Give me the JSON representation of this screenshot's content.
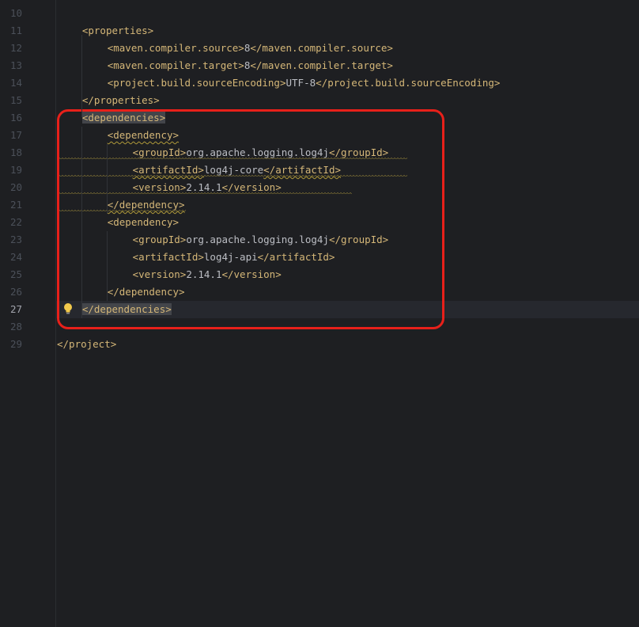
{
  "editor": {
    "current_line": "27",
    "lines": [
      {
        "num": "10",
        "parts": []
      },
      {
        "num": "11",
        "parts": [
          {
            "t": "tag",
            "v": "<properties>"
          }
        ]
      },
      {
        "num": "12",
        "parts": [
          {
            "t": "tag",
            "v": "<maven.compiler.source>"
          },
          {
            "t": "txt",
            "v": "8"
          },
          {
            "t": "tag",
            "v": "</maven.compiler.source>"
          }
        ]
      },
      {
        "num": "13",
        "parts": [
          {
            "t": "tag",
            "v": "<maven.compiler.target>"
          },
          {
            "t": "txt",
            "v": "8"
          },
          {
            "t": "tag",
            "v": "</maven.compiler.target>"
          }
        ]
      },
      {
        "num": "14",
        "parts": [
          {
            "t": "tag",
            "v": "<project.build.sourceEncoding>"
          },
          {
            "t": "txt",
            "v": "UTF-8"
          },
          {
            "t": "tag",
            "v": "</project.build.sourceEncoding>"
          }
        ]
      },
      {
        "num": "15",
        "parts": [
          {
            "t": "tag",
            "v": "</properties>"
          }
        ]
      },
      {
        "num": "16",
        "parts": [
          {
            "t": "tag",
            "v": "<dependencies>"
          }
        ]
      },
      {
        "num": "17",
        "parts": [
          {
            "t": "tag",
            "v": "<dependency>"
          }
        ]
      },
      {
        "num": "18",
        "parts": [
          {
            "t": "tag",
            "v": "<groupId>"
          },
          {
            "t": "txt",
            "v": "org.apache.logging.log4j"
          },
          {
            "t": "tag",
            "v": "</groupId>"
          }
        ]
      },
      {
        "num": "19",
        "parts": [
          {
            "t": "tag",
            "v": "<artifactId>"
          },
          {
            "t": "txt",
            "v": "log4j-core"
          },
          {
            "t": "tag",
            "v": "</artifactId>"
          }
        ]
      },
      {
        "num": "20",
        "parts": [
          {
            "t": "tag",
            "v": "<version>"
          },
          {
            "t": "txt",
            "v": "2.14.1"
          },
          {
            "t": "tag",
            "v": "</version>"
          }
        ]
      },
      {
        "num": "21",
        "parts": [
          {
            "t": "tag",
            "v": "</dependency>"
          }
        ]
      },
      {
        "num": "22",
        "parts": [
          {
            "t": "tag",
            "v": "<dependency>"
          }
        ]
      },
      {
        "num": "23",
        "parts": [
          {
            "t": "tag",
            "v": "<groupId>"
          },
          {
            "t": "txt",
            "v": "org.apache.logging.log4j"
          },
          {
            "t": "tag",
            "v": "</groupId>"
          }
        ]
      },
      {
        "num": "24",
        "parts": [
          {
            "t": "tag",
            "v": "<artifactId>"
          },
          {
            "t": "txt",
            "v": "log4j-api"
          },
          {
            "t": "tag",
            "v": "</artifactId>"
          }
        ]
      },
      {
        "num": "25",
        "parts": [
          {
            "t": "tag",
            "v": "<version>"
          },
          {
            "t": "txt",
            "v": "2.14.1"
          },
          {
            "t": "tag",
            "v": "</version>"
          }
        ]
      },
      {
        "num": "26",
        "parts": [
          {
            "t": "tag",
            "v": "</dependency>"
          }
        ]
      },
      {
        "num": "27",
        "parts": [
          {
            "t": "tag",
            "v": "</dependencies>"
          }
        ]
      },
      {
        "num": "28",
        "parts": []
      },
      {
        "num": "29",
        "parts": [
          {
            "t": "tag",
            "v": "</project>"
          }
        ]
      }
    ]
  },
  "colors": {
    "background": "#1e1f22",
    "tag": "#d5b778",
    "text": "#bcbec4",
    "line_number": "#4b5059",
    "annotation_box": "#e8201a",
    "warning_squiggle": "#b09a3a"
  },
  "icons": {
    "intention": "lightbulb-icon"
  }
}
